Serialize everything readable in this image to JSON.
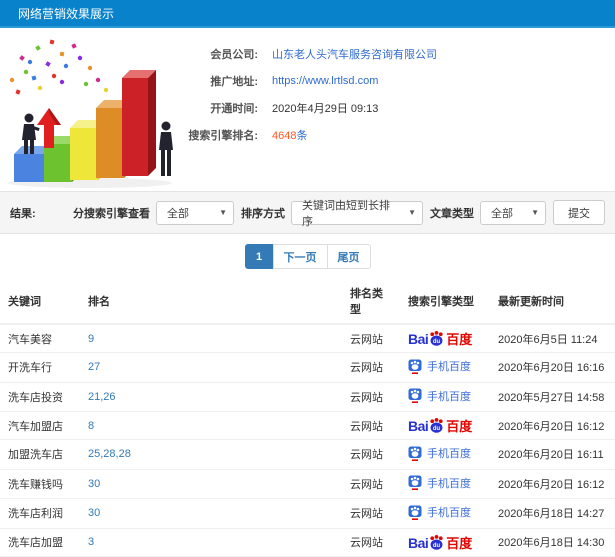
{
  "header": {
    "title": "网络营销效果展示"
  },
  "illustration": {
    "name": "3d-bar-chart-growth-clipart",
    "bar_colors": [
      "#4a84e0",
      "#6cc22f",
      "#efe63a",
      "#de8c26",
      "#cd2128"
    ],
    "arrow_color": "#e02020",
    "figure_color": "#23232f"
  },
  "info": {
    "rows": [
      {
        "label": "会员公司:",
        "value": "山东老人头汽车服务咨询有限公司",
        "type": "link"
      },
      {
        "label": "推广地址:",
        "value": "https://www.lrtlsd.com",
        "type": "link"
      },
      {
        "label": "开通时间:",
        "value": "2020年4月29日 09:13",
        "type": "text"
      },
      {
        "label": "搜索引擎排名:",
        "value": "4648",
        "suffix": "条",
        "type": "highlight"
      }
    ]
  },
  "filters": {
    "result_label": "结果:",
    "engine_view": {
      "label": "分搜索引擎查看",
      "value": "全部"
    },
    "sort": {
      "label": "排序方式",
      "value": "关键词由短到长排序"
    },
    "article_type": {
      "label": "文章类型",
      "value": "全部"
    },
    "submit_label": "提交"
  },
  "pagination": {
    "items": [
      {
        "label": "1",
        "active": true
      },
      {
        "label": "下一页",
        "active": false
      },
      {
        "label": "尾页",
        "active": false
      }
    ]
  },
  "table": {
    "headers": [
      "关键词",
      "排名",
      "排名类型",
      "搜索引擎类型",
      "最新更新时间"
    ],
    "baidu_pc": {
      "text_latin": "Bai",
      "text_cn": "百度"
    },
    "baidu_mobile": {
      "label": "手机百度"
    },
    "rows": [
      {
        "keyword": "汽车美容",
        "rank": "9",
        "rank_type": "云网站",
        "engine": "baidu-pc",
        "engine_label": "百度",
        "updated": "2020年6月5日 11:24"
      },
      {
        "keyword": "开洗车行",
        "rank": "27",
        "rank_type": "云网站",
        "engine": "baidu-mobile",
        "engine_label": "手机百度",
        "updated": "2020年6月20日 16:16"
      },
      {
        "keyword": "洗车店投资",
        "rank": "21,26",
        "rank_type": "云网站",
        "engine": "baidu-mobile",
        "engine_label": "手机百度",
        "updated": "2020年5月27日 14:58"
      },
      {
        "keyword": "汽车加盟店",
        "rank": "8",
        "rank_type": "云网站",
        "engine": "baidu-pc",
        "engine_label": "百度",
        "updated": "2020年6月20日 16:12"
      },
      {
        "keyword": "加盟洗车店",
        "rank": "25,28,28",
        "rank_type": "云网站",
        "engine": "baidu-mobile",
        "engine_label": "手机百度",
        "updated": "2020年6月20日 16:11"
      },
      {
        "keyword": "洗车赚钱吗",
        "rank": "30",
        "rank_type": "云网站",
        "engine": "baidu-mobile",
        "engine_label": "手机百度",
        "updated": "2020年6月20日 16:12"
      },
      {
        "keyword": "洗车店利润",
        "rank": "30",
        "rank_type": "云网站",
        "engine": "baidu-mobile",
        "engine_label": "手机百度",
        "updated": "2020年6月18日 14:27"
      },
      {
        "keyword": "洗车店加盟",
        "rank": "3",
        "rank_type": "云网站",
        "engine": "baidu-pc",
        "engine_label": "百度",
        "updated": "2020年6月18日 14:30"
      }
    ]
  },
  "colors": {
    "header_bg": "#0782cb",
    "link_blue": "#2f6bd0",
    "rank_blue": "#337ab7",
    "highlight_orange": "#ff5722",
    "baidu_blue": "#2932d1",
    "baidu_red": "#e10601",
    "filter_bg": "#f5f5f5"
  }
}
